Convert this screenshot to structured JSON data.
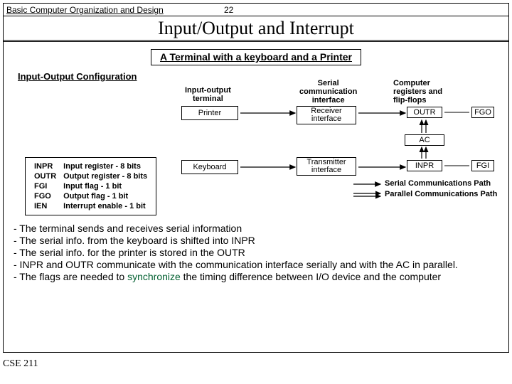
{
  "head": {
    "chapter": "Basic Computer Organization and Design",
    "page": "22"
  },
  "title": "Input/Output and Interrupt",
  "subtitle": "A Terminal with a keyboard and a Printer",
  "cfg": "Input-Output Configuration",
  "col": {
    "term1": "Input-output",
    "term2": "terminal",
    "ser1": "Serial",
    "ser2": "communication",
    "ser3": "interface",
    "comp1": "Computer",
    "comp2": "registers and",
    "comp3": "flip-flops"
  },
  "boxes": {
    "printer": "Printer",
    "keyboard": "Keyboard",
    "recv1": "Receiver",
    "recv2": "interface",
    "trans1": "Transmitter",
    "trans2": "interface",
    "outr": "OUTR",
    "inpr": "INPR",
    "fgo": "FGO",
    "fgi": "FGI",
    "ac": "AC"
  },
  "legend": {
    "serial": "Serial Communications Path",
    "parallel": "Parallel Communications Path"
  },
  "reg": {
    "r1c1": "INPR",
    "r1c2": "Input register - 8 bits",
    "r2c1": "OUTR",
    "r2c2": "Output register - 8 bits",
    "r3c1": "FGI",
    "r3c2": "Input flag - 1 bit",
    "r4c1": "FGO",
    "r4c2": "Output flag - 1 bit",
    "r5c1": "IEN",
    "r5c2": "Interrupt enable - 1 bit"
  },
  "notes": {
    "l1": "- The terminal sends and receives serial information",
    "l2": "- The serial info. from the keyboard is shifted into INPR",
    "l3": "- The serial info. for the printer is stored in the OUTR",
    "l4": "- INPR and OUTR communicate with the communication interface serially and with the AC in parallel.",
    "l5a": "- The flags are needed to ",
    "l5b": "synchronize",
    "l5c": " the timing difference between  I/O device and the computer"
  },
  "footer": "CSE 211"
}
